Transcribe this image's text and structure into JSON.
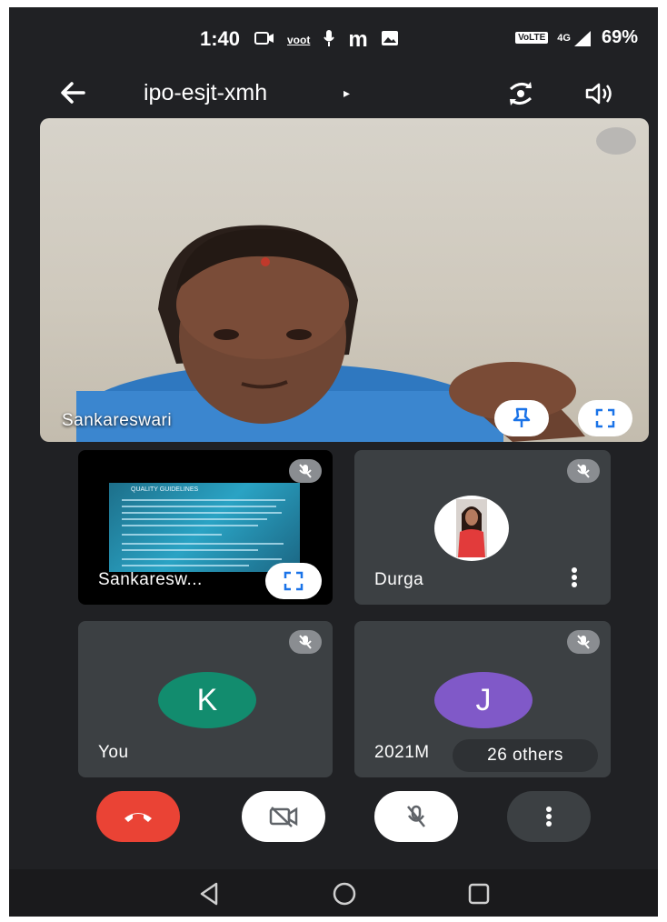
{
  "status_bar": {
    "time": "1:40",
    "carrier_app": "voot",
    "volte_badge": "VoLTE",
    "network": "4G",
    "battery": "69%"
  },
  "top_bar": {
    "meeting_code": "ipo-esjt-xmh",
    "caret": "▸"
  },
  "main_tile": {
    "participant_name": "Sankareswari"
  },
  "tiles": [
    {
      "label": "Sankaresw...",
      "type": "presentation",
      "slide_title": "QUALITY GUIDELINES"
    },
    {
      "label": "Durga",
      "type": "photo"
    },
    {
      "label": "You",
      "type": "initial",
      "initial": "K",
      "avatar_color": "#128c6e"
    },
    {
      "label": "2021M",
      "type": "initial",
      "initial": "J",
      "avatar_color": "#8059c8",
      "others_pill": "26 others"
    }
  ],
  "colors": {
    "end_call": "#ea4335",
    "tile_bg": "#3c4043",
    "app_bg": "#202124"
  },
  "icons": {
    "back": "arrow-left-icon",
    "flip": "flip-camera-icon",
    "audio": "speaker-icon",
    "pin": "pin-icon",
    "expand": "fullscreen-icon",
    "muted": "mic-off-icon",
    "end": "phone-hangup-icon",
    "camera": "video-off-icon",
    "more": "more-vert-icon"
  }
}
